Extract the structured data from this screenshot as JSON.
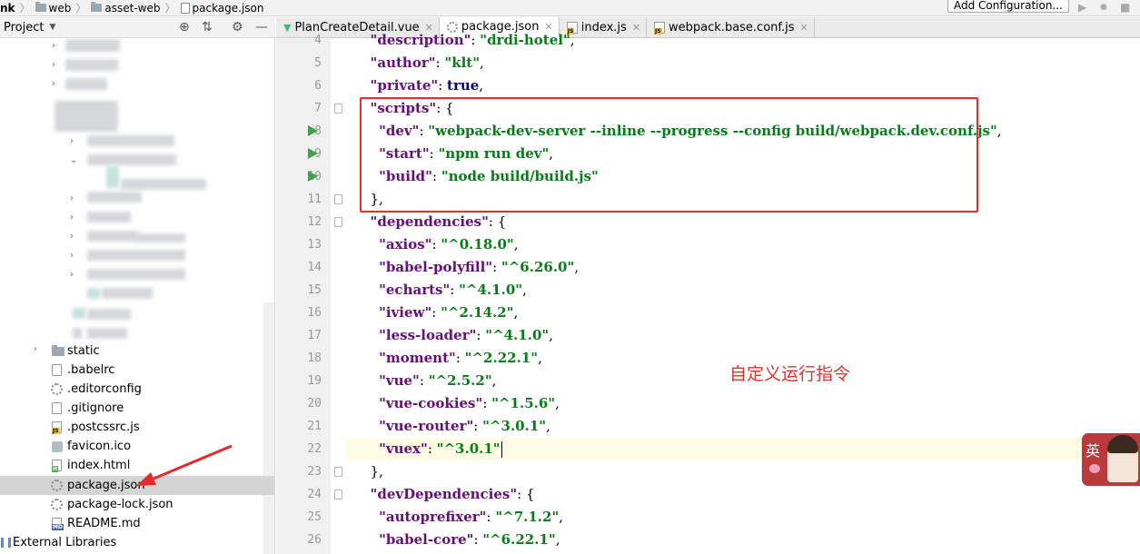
{
  "breadcrumb": {
    "items": [
      "nk",
      "web",
      "asset-web",
      "package.json"
    ]
  },
  "toolbar": {
    "add_configuration": "Add Configuration..."
  },
  "project_panel": {
    "title": "Project",
    "tree": [
      {
        "label": "static",
        "type": "folder"
      },
      {
        "label": ".babelrc",
        "type": "file"
      },
      {
        "label": ".editorconfig",
        "type": "gear"
      },
      {
        "label": ".gitignore",
        "type": "file"
      },
      {
        "label": ".postcssrc.js",
        "type": "js"
      },
      {
        "label": "favicon.ico",
        "type": "ico"
      },
      {
        "label": "index.html",
        "type": "html"
      },
      {
        "label": "package.json",
        "type": "json"
      },
      {
        "label": "package-lock.json",
        "type": "json"
      },
      {
        "label": "README.md",
        "type": "md"
      }
    ],
    "external_libraries": "External Libraries"
  },
  "tabs": [
    {
      "label": "PlanCreateDetail.vue",
      "icon": "vue-icon"
    },
    {
      "label": "package.json",
      "icon": "json-icon",
      "active": true
    },
    {
      "label": "index.js",
      "icon": "js-icon"
    },
    {
      "label": "webpack.base.conf.js",
      "icon": "js-icon"
    }
  ],
  "editor": {
    "lines": [
      {
        "n": "4",
        "tokens": [
          [
            "p",
            "  "
          ],
          [
            "k",
            "\"description\""
          ],
          [
            "p",
            ": "
          ],
          [
            "s",
            "\"drdi-hotel\""
          ],
          [
            "p",
            ","
          ]
        ]
      },
      {
        "n": "5",
        "tokens": [
          [
            "p",
            "  "
          ],
          [
            "k",
            "\"author\""
          ],
          [
            "p",
            ": "
          ],
          [
            "s",
            "\"klt\""
          ],
          [
            "p",
            ","
          ]
        ]
      },
      {
        "n": "6",
        "tokens": [
          [
            "p",
            "  "
          ],
          [
            "k",
            "\"private\""
          ],
          [
            "p",
            ": "
          ],
          [
            "b",
            "true"
          ],
          [
            "p",
            ","
          ]
        ]
      },
      {
        "n": "7",
        "tokens": [
          [
            "p",
            "  "
          ],
          [
            "k",
            "\"scripts\""
          ],
          [
            "p",
            ": {"
          ]
        ]
      },
      {
        "n": "8",
        "tokens": [
          [
            "p",
            "    "
          ],
          [
            "k",
            "\"dev\""
          ],
          [
            "p",
            ": "
          ],
          [
            "s",
            "\"webpack-dev-server --inline --progress --config build/webpack.dev.conf.js\""
          ],
          [
            "p",
            ","
          ]
        ]
      },
      {
        "n": "9",
        "tokens": [
          [
            "p",
            "    "
          ],
          [
            "k",
            "\"start\""
          ],
          [
            "p",
            ": "
          ],
          [
            "s",
            "\"npm run dev\""
          ],
          [
            "p",
            ","
          ]
        ]
      },
      {
        "n": "10",
        "tokens": [
          [
            "p",
            "    "
          ],
          [
            "k",
            "\"build\""
          ],
          [
            "p",
            ": "
          ],
          [
            "s",
            "\"node build/build.js\""
          ]
        ]
      },
      {
        "n": "11",
        "tokens": [
          [
            "p",
            "  },"
          ]
        ]
      },
      {
        "n": "12",
        "tokens": [
          [
            "p",
            "  "
          ],
          [
            "k",
            "\"dependencies\""
          ],
          [
            "p",
            ": {"
          ]
        ]
      },
      {
        "n": "13",
        "tokens": [
          [
            "p",
            "    "
          ],
          [
            "k",
            "\"axios\""
          ],
          [
            "p",
            ": "
          ],
          [
            "s",
            "\"^0.18.0\""
          ],
          [
            "p",
            ","
          ]
        ]
      },
      {
        "n": "14",
        "tokens": [
          [
            "p",
            "    "
          ],
          [
            "k",
            "\"babel-polyfill\""
          ],
          [
            "p",
            ": "
          ],
          [
            "s",
            "\"^6.26.0\""
          ],
          [
            "p",
            ","
          ]
        ]
      },
      {
        "n": "15",
        "tokens": [
          [
            "p",
            "    "
          ],
          [
            "k",
            "\"echarts\""
          ],
          [
            "p",
            ": "
          ],
          [
            "s",
            "\"^4.1.0\""
          ],
          [
            "p",
            ","
          ]
        ]
      },
      {
        "n": "16",
        "tokens": [
          [
            "p",
            "    "
          ],
          [
            "k",
            "\"iview\""
          ],
          [
            "p",
            ": "
          ],
          [
            "s",
            "\"^2.14.2\""
          ],
          [
            "p",
            ","
          ]
        ]
      },
      {
        "n": "17",
        "tokens": [
          [
            "p",
            "    "
          ],
          [
            "k",
            "\"less-loader\""
          ],
          [
            "p",
            ": "
          ],
          [
            "s",
            "\"^4.1.0\""
          ],
          [
            "p",
            ","
          ]
        ]
      },
      {
        "n": "18",
        "tokens": [
          [
            "p",
            "    "
          ],
          [
            "k",
            "\"moment\""
          ],
          [
            "p",
            ": "
          ],
          [
            "s",
            "\"^2.22.1\""
          ],
          [
            "p",
            ","
          ]
        ]
      },
      {
        "n": "19",
        "tokens": [
          [
            "p",
            "    "
          ],
          [
            "k",
            "\"vue\""
          ],
          [
            "p",
            ": "
          ],
          [
            "s",
            "\"^2.5.2\""
          ],
          [
            "p",
            ","
          ]
        ]
      },
      {
        "n": "20",
        "tokens": [
          [
            "p",
            "    "
          ],
          [
            "k",
            "\"vue-cookies\""
          ],
          [
            "p",
            ": "
          ],
          [
            "s",
            "\"^1.5.6\""
          ],
          [
            "p",
            ","
          ]
        ]
      },
      {
        "n": "21",
        "tokens": [
          [
            "p",
            "    "
          ],
          [
            "k",
            "\"vue-router\""
          ],
          [
            "p",
            ": "
          ],
          [
            "s",
            "\"^3.0.1\""
          ],
          [
            "p",
            ","
          ]
        ]
      },
      {
        "n": "22",
        "tokens": [
          [
            "p",
            "    "
          ],
          [
            "k",
            "\"vuex\""
          ],
          [
            "p",
            ": "
          ],
          [
            "s",
            "\"^3.0.1\""
          ]
        ]
      },
      {
        "n": "23",
        "tokens": [
          [
            "p",
            "  },"
          ]
        ]
      },
      {
        "n": "24",
        "tokens": [
          [
            "p",
            "  "
          ],
          [
            "k",
            "\"devDependencies\""
          ],
          [
            "p",
            ": {"
          ]
        ]
      },
      {
        "n": "25",
        "tokens": [
          [
            "p",
            "    "
          ],
          [
            "k",
            "\"autoprefixer\""
          ],
          [
            "p",
            ": "
          ],
          [
            "s",
            "\"^7.1.2\""
          ],
          [
            "p",
            ","
          ]
        ]
      },
      {
        "n": "26",
        "tokens": [
          [
            "p",
            "    "
          ],
          [
            "k",
            "\"babel-core\""
          ],
          [
            "p",
            ": "
          ],
          [
            "s",
            "\"^6.22.1\""
          ],
          [
            "p",
            ","
          ]
        ]
      }
    ]
  },
  "annotation": {
    "text": "自定义运行指令"
  },
  "avatar_widget": {
    "char": "英"
  },
  "colors": {
    "highlight_box": "#e52b2b",
    "annotation_text": "#e5302b",
    "key": "#660e7a",
    "string": "#067d17",
    "keyword": "#000080"
  }
}
